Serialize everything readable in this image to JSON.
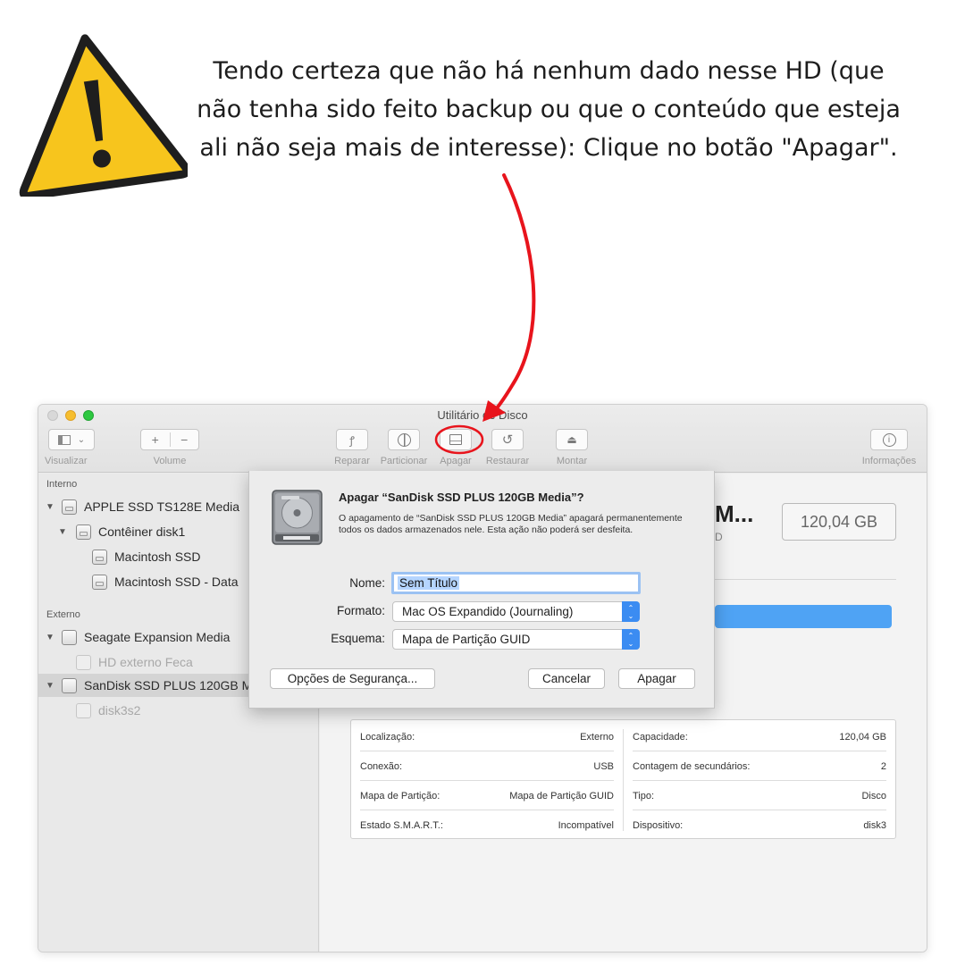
{
  "instruction": {
    "line1": "Tendo certeza que não há nenhum dado nesse HD (que",
    "line2": "não tenha sido feito backup ou que o conteúdo que esteja",
    "line3": "ali não seja mais de interesse): Clique no botão \"Apagar\"."
  },
  "colors": {
    "arrow": "#e8141c",
    "warning_yellow": "#f7c51d",
    "accent_blue": "#3b8cf2"
  },
  "window": {
    "title": "Utilitário de Disco",
    "toolbar": {
      "visualizar": "Visualizar",
      "volume": "Volume",
      "reparar": "Reparar",
      "particionar": "Particionar",
      "apagar": "Apagar",
      "restaurar": "Restaurar",
      "montar": "Montar",
      "informacoes": "Informações"
    },
    "sidebar": {
      "internal_header": "Interno",
      "external_header": "Externo",
      "items": [
        {
          "label": "APPLE SSD TS128E Media"
        },
        {
          "label": "Contêiner disk1"
        },
        {
          "label": "Macintosh SSD"
        },
        {
          "label": "Macintosh SSD - Data"
        },
        {
          "label": "Seagate Expansion Media"
        },
        {
          "label": "HD externo Feca"
        },
        {
          "label": "SanDisk SSD PLUS 120GB M"
        },
        {
          "label": "disk3s2"
        }
      ]
    },
    "main": {
      "volume_name": "M...",
      "volume_sub": "D",
      "size": "120,04 GB",
      "info": {
        "localizacao_label": "Localização:",
        "localizacao_value": "Externo",
        "capacidade_label": "Capacidade:",
        "capacidade_value": "120,04 GB",
        "conexao_label": "Conexão:",
        "conexao_value": "USB",
        "contagem_label": "Contagem de secundários:",
        "contagem_value": "2",
        "mapa_label": "Mapa de Partição:",
        "mapa_value": "Mapa de Partição GUID",
        "tipo_label": "Tipo:",
        "tipo_value": "Disco",
        "smart_label": "Estado S.M.A.R.T.:",
        "smart_value": "Incompatível",
        "dispositivo_label": "Dispositivo:",
        "dispositivo_value": "disk3"
      }
    }
  },
  "dialog": {
    "title": "Apagar “SanDisk SSD PLUS 120GB Media”?",
    "message": "O apagamento de “SanDisk SSD PLUS 120GB Media” apagará permanentemente todos os dados armazenados nele. Esta ação não poderá ser desfeita.",
    "name_label": "Nome:",
    "name_value": "Sem Título",
    "format_label": "Formato:",
    "format_value": "Mac OS Expandido (Journaling)",
    "scheme_label": "Esquema:",
    "scheme_value": "Mapa de Partição GUID",
    "security_button": "Opções de Segurança...",
    "cancel_button": "Cancelar",
    "erase_button": "Apagar"
  }
}
